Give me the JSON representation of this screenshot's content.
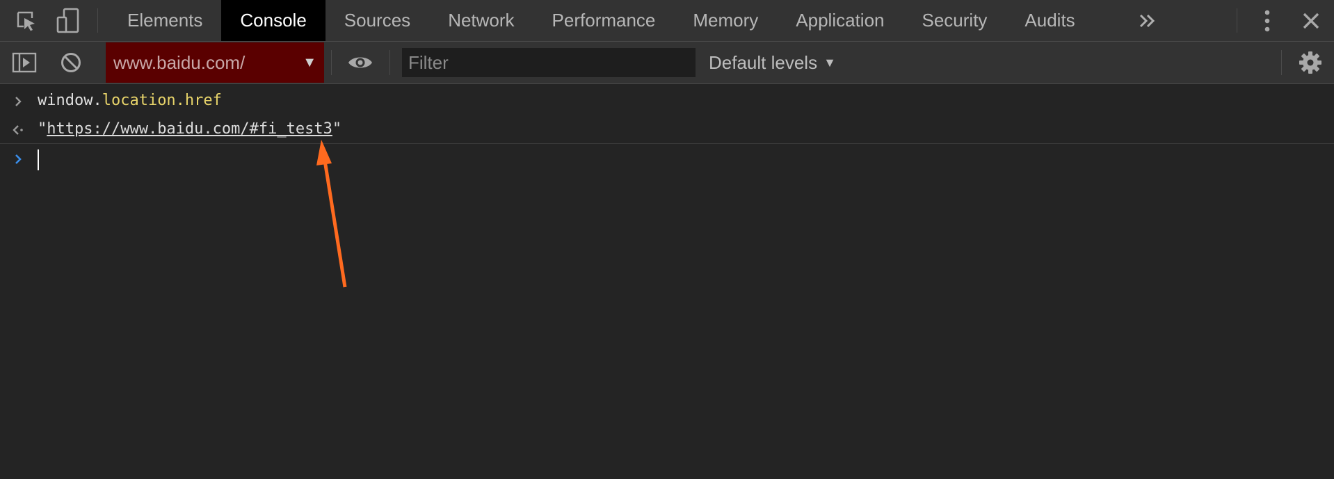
{
  "tabbar": {
    "tabs": [
      {
        "label": "Elements",
        "active": false
      },
      {
        "label": "Console",
        "active": true
      },
      {
        "label": "Sources",
        "active": false
      },
      {
        "label": "Network",
        "active": false
      },
      {
        "label": "Performance",
        "active": false
      },
      {
        "label": "Memory",
        "active": false
      },
      {
        "label": "Application",
        "active": false
      },
      {
        "label": "Security",
        "active": false
      },
      {
        "label": "Audits",
        "active": false
      }
    ],
    "icons": [
      "inspect-element-icon",
      "device-toggle-icon",
      "more-tabs-icon",
      "kebab-menu-icon",
      "close-icon"
    ]
  },
  "toolbar": {
    "context": "www.baidu.com/",
    "filter_placeholder": "Filter",
    "filter_value": "",
    "levels": "Default levels",
    "icons": [
      "sidebar-toggle-icon",
      "clear-console-icon",
      "eye-icon",
      "settings-icon"
    ]
  },
  "console": {
    "input_line": {
      "object": "window.",
      "property": "location.href"
    },
    "result_line": {
      "open_quote": "\"",
      "url": "https://www.baidu.com/#fi_test3",
      "close_quote": "\""
    },
    "prompt_value": ""
  },
  "colors": {
    "panel_bg": "#242424",
    "toolbar_bg": "#333333",
    "active_tab_bg": "#000000",
    "context_bg": "#5a0000",
    "prompt_blue": "#3b8eea",
    "property_yellow": "#e8d46a",
    "annotation_arrow": "#ff6a1f"
  }
}
